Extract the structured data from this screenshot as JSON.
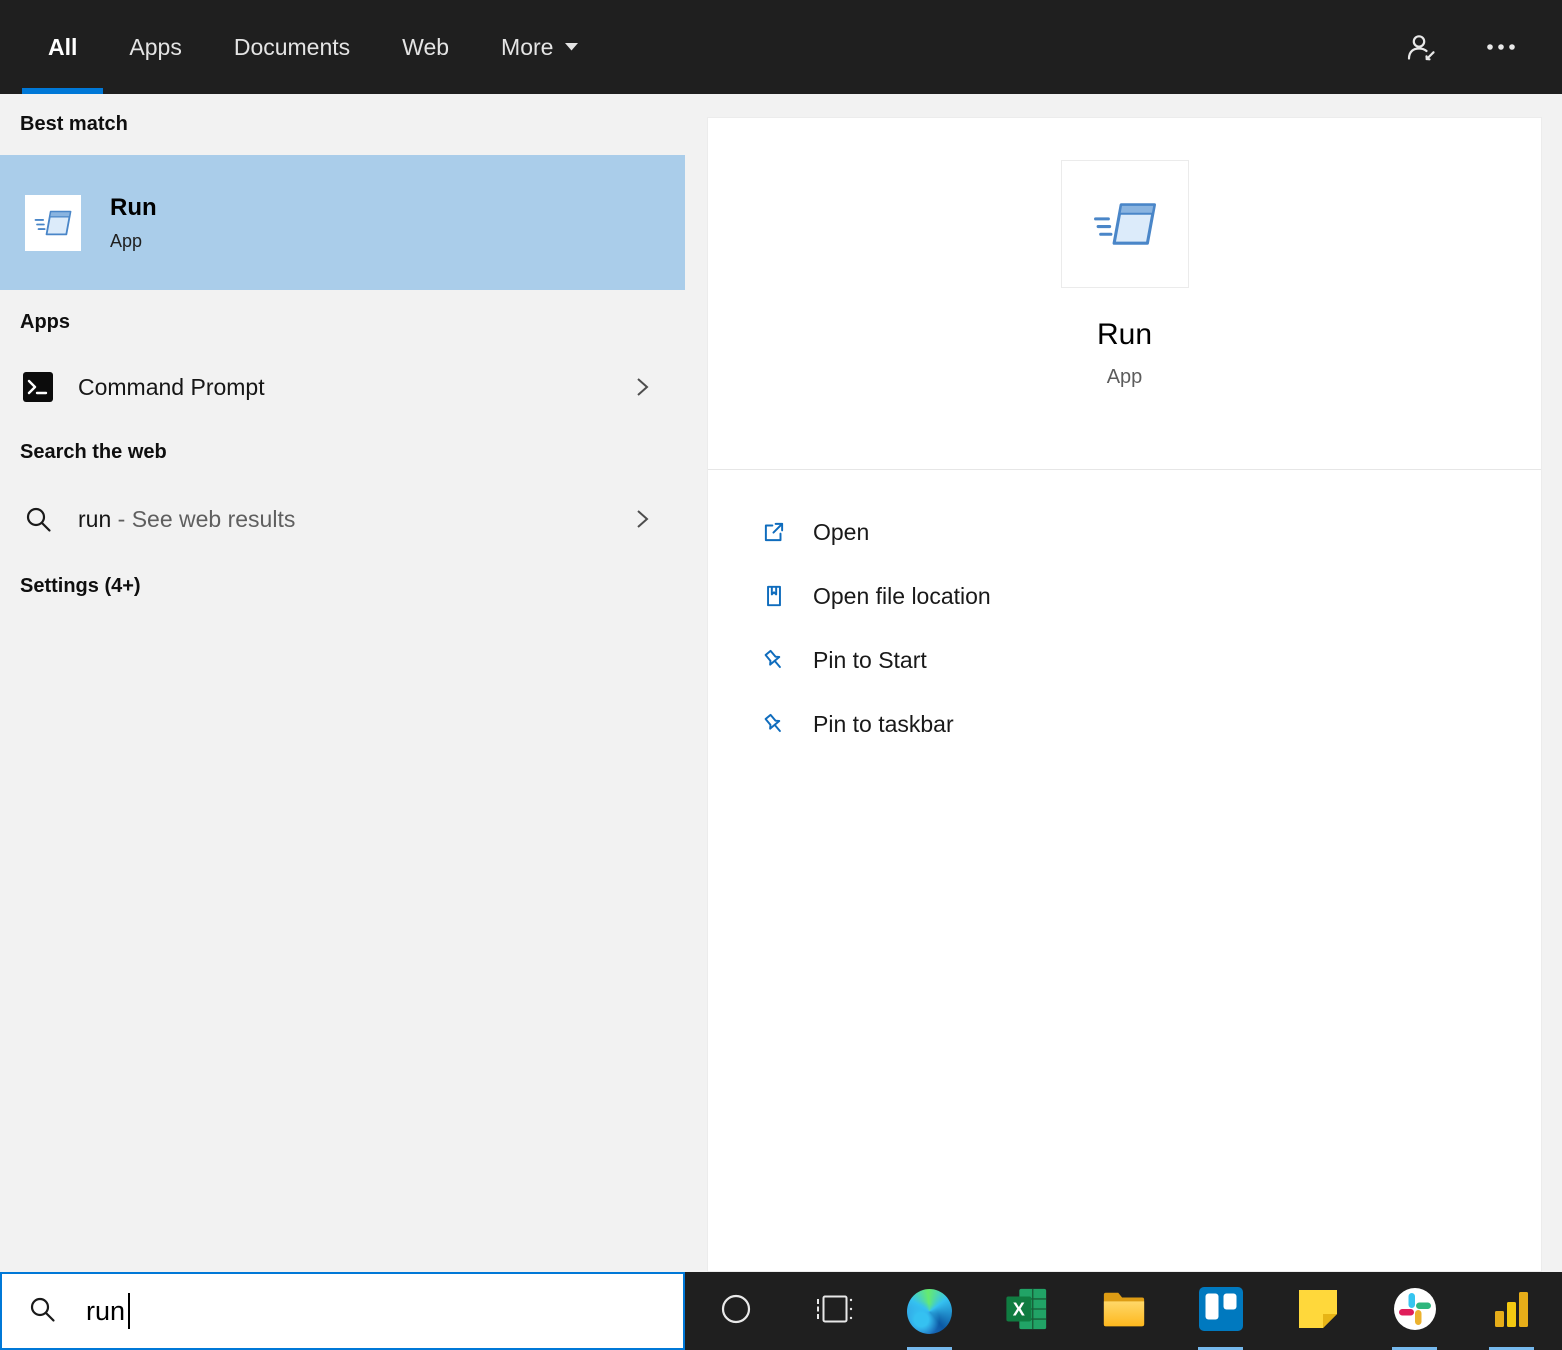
{
  "colors": {
    "accent": "#0078d7",
    "topbar_bg": "#1f1f1f",
    "panel_bg": "#f2f2f2",
    "selected_bg": "#aacdea",
    "card_bg": "#ffffff",
    "icon_blue": "#0f6cbd",
    "taskbar_bg": "#1f1f1f",
    "running_indicator": "#76b9ed"
  },
  "topbar": {
    "tabs": [
      {
        "label": "All",
        "active": true
      },
      {
        "label": "Apps",
        "active": false
      },
      {
        "label": "Documents",
        "active": false
      },
      {
        "label": "Web",
        "active": false
      },
      {
        "label": "More",
        "active": false,
        "dropdown": true
      }
    ],
    "account_icon": "account-icon",
    "more_options_icon": "ellipsis-icon"
  },
  "panel": {
    "sections": {
      "best_match": "Best match",
      "apps": "Apps",
      "web": "Search the web",
      "settings": "Settings (4+)"
    },
    "best_match_item": {
      "title": "Run",
      "subtitle": "App",
      "icon": "run-app-icon"
    },
    "apps_items": [
      {
        "label": "Command Prompt",
        "icon": "command-prompt-icon",
        "expander": "chevron-right-icon"
      }
    ],
    "web_item": {
      "query": "run",
      "suffix": "- See web results",
      "icon": "search-icon",
      "expander": "chevron-right-icon"
    }
  },
  "preview": {
    "title": "Run",
    "subtitle": "App",
    "icon": "run-app-icon",
    "actions": [
      {
        "label": "Open",
        "icon": "open-icon"
      },
      {
        "label": "Open file location",
        "icon": "open-file-location-icon"
      },
      {
        "label": "Pin to Start",
        "icon": "pin-icon"
      },
      {
        "label": "Pin to taskbar",
        "icon": "pin-icon"
      }
    ]
  },
  "search": {
    "value": "run",
    "icon": "search-icon"
  },
  "taskbar": {
    "items": [
      {
        "name": "cortana",
        "icon": "cortana-icon",
        "running": false
      },
      {
        "name": "task-view",
        "icon": "task-view-icon",
        "running": false
      },
      {
        "name": "edge",
        "icon": "edge-icon",
        "running": true
      },
      {
        "name": "excel",
        "icon": "excel-icon",
        "running": false
      },
      {
        "name": "file-explorer",
        "icon": "file-explorer-icon",
        "running": false
      },
      {
        "name": "trello",
        "icon": "trello-icon",
        "running": true
      },
      {
        "name": "sticky-notes",
        "icon": "sticky-notes-icon",
        "running": false
      },
      {
        "name": "slack",
        "icon": "slack-icon",
        "running": true
      },
      {
        "name": "power-bi",
        "icon": "power-bi-icon",
        "running": true
      }
    ]
  }
}
